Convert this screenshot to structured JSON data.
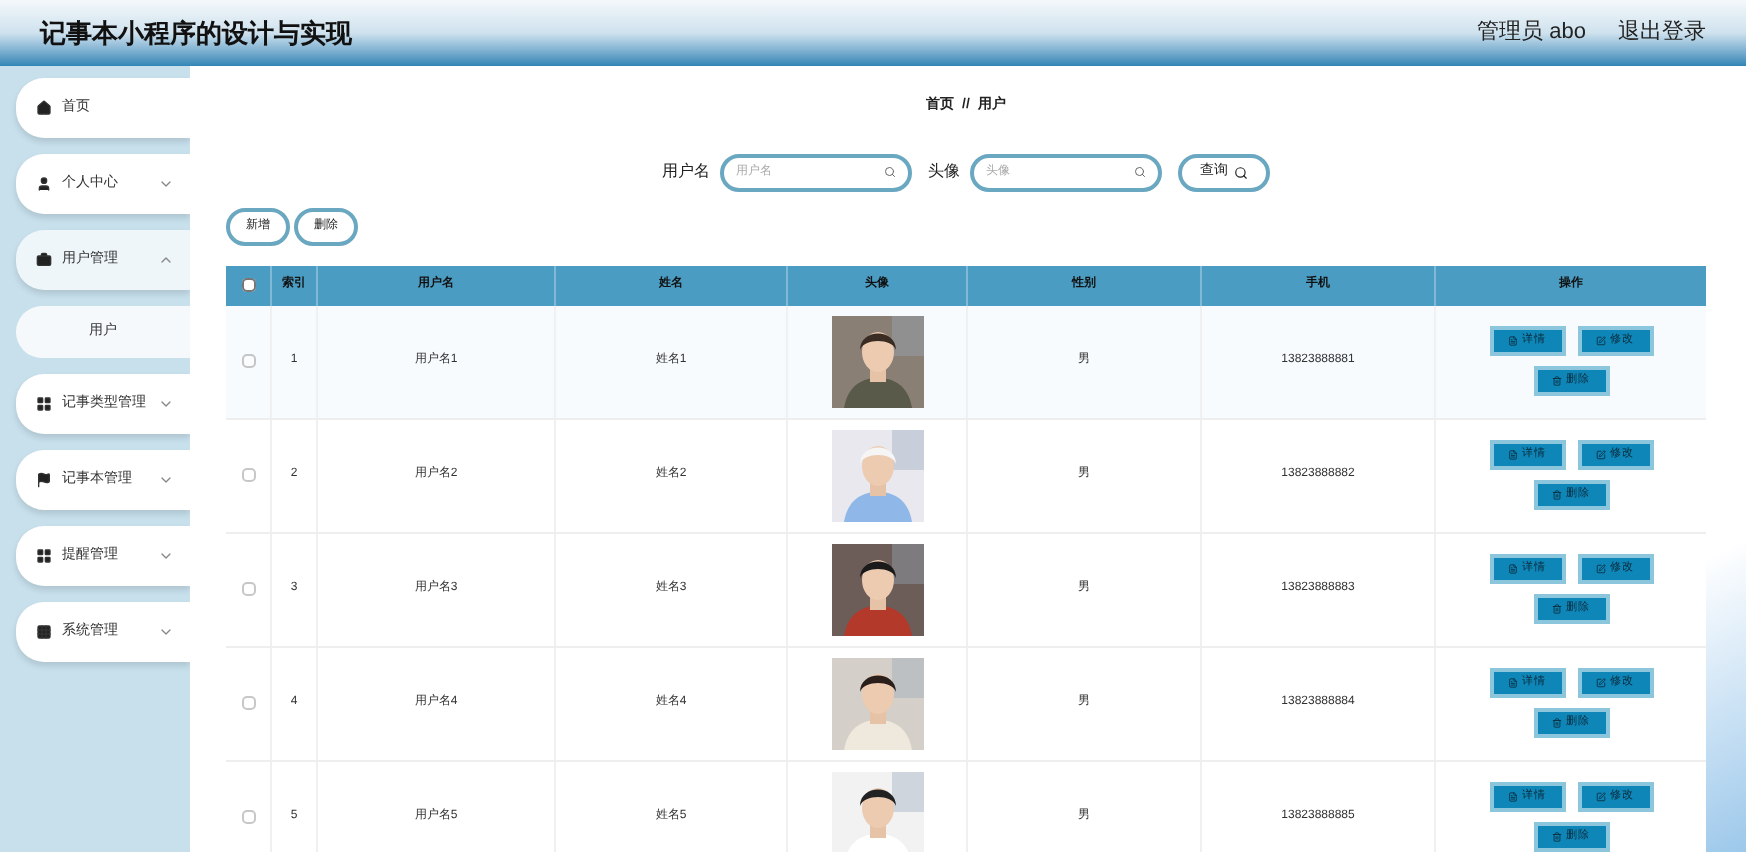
{
  "header": {
    "title": "记事本小程序的设计与实现",
    "user": "管理员 abo",
    "logout": "退出登录"
  },
  "sidebar": {
    "items": [
      {
        "label": "首页",
        "expanded": false
      },
      {
        "label": "个人中心",
        "expanded": false
      },
      {
        "label": "用户管理",
        "expanded": true,
        "children": [
          {
            "label": "用户"
          }
        ]
      },
      {
        "label": "记事类型管理",
        "expanded": false
      },
      {
        "label": "记事本管理",
        "expanded": false
      },
      {
        "label": "提醒管理",
        "expanded": false
      },
      {
        "label": "系统管理",
        "expanded": false
      }
    ]
  },
  "breadcrumb": {
    "home": "首页",
    "separator": "//",
    "current": "用户"
  },
  "search": {
    "fields": [
      {
        "label": "用户名",
        "placeholder": "用户名"
      },
      {
        "label": "头像",
        "placeholder": "头像"
      }
    ],
    "button": "查询"
  },
  "actions": [
    "新增",
    "删除"
  ],
  "table": {
    "all_checked": false,
    "columns": [
      "索引",
      "用户名",
      "姓名",
      "头像",
      "性别",
      "手机",
      "操作"
    ],
    "rows": [
      {
        "index": "1",
        "username": "用户名1",
        "name": "姓名1",
        "gender": "男",
        "phone": "13823888881",
        "checked": false,
        "buttons": [
          "详情",
          "修改",
          "删除"
        ]
      },
      {
        "index": "2",
        "username": "用户名2",
        "name": "姓名2",
        "gender": "男",
        "phone": "13823888882",
        "checked": false,
        "buttons": [
          "详情",
          "修改",
          "删除"
        ]
      },
      {
        "index": "3",
        "username": "用户名3",
        "name": "姓名3",
        "gender": "男",
        "phone": "13823888883",
        "checked": false,
        "buttons": [
          "详情",
          "修改",
          "删除"
        ]
      },
      {
        "index": "4",
        "username": "用户名4",
        "name": "姓名4",
        "gender": "男",
        "phone": "13823888884",
        "checked": false,
        "buttons": [
          "详情",
          "修改",
          "删除"
        ]
      },
      {
        "index": "5",
        "username": "用户名5",
        "name": "姓名5",
        "gender": "男",
        "phone": "13823888885",
        "checked": false,
        "buttons": [
          "详情",
          "修改",
          "删除"
        ]
      }
    ]
  }
}
